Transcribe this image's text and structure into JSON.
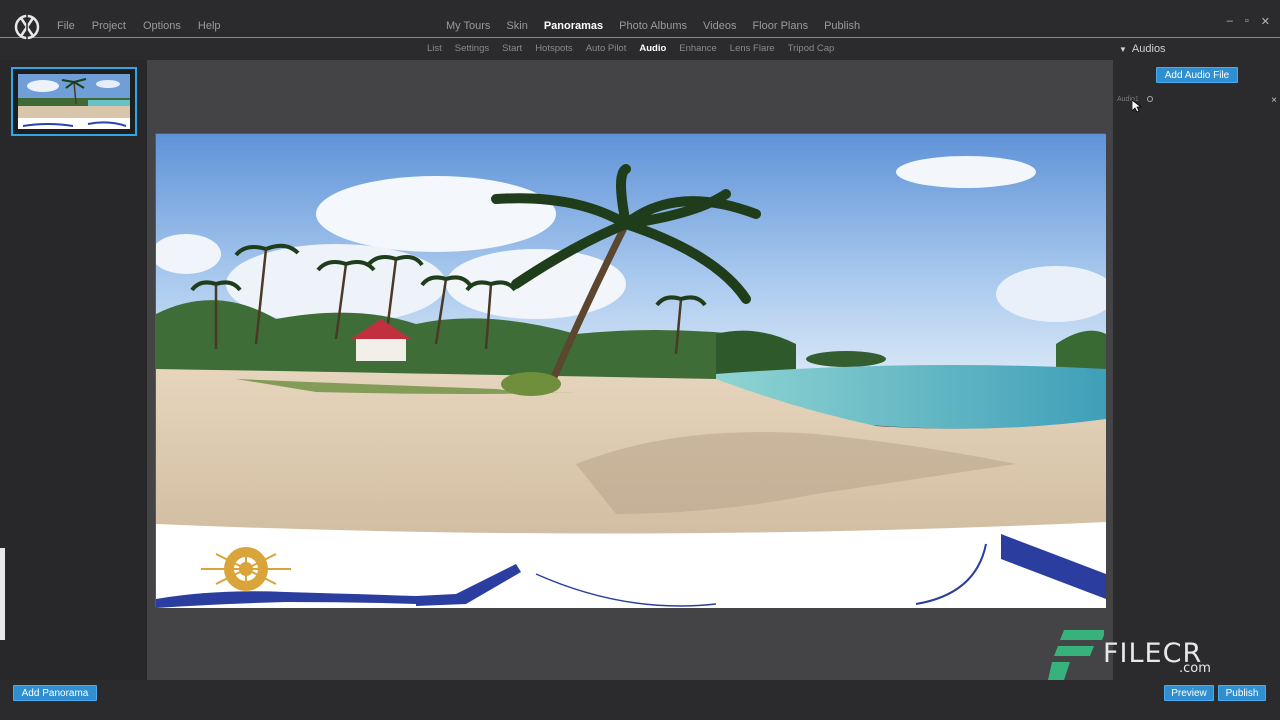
{
  "menu": {
    "file": "File",
    "project": "Project",
    "options": "Options",
    "help": "Help"
  },
  "topnav": {
    "items": [
      "My Tours",
      "Skin",
      "Panoramas",
      "Photo Albums",
      "Videos",
      "Floor Plans",
      "Publish"
    ],
    "active": "Panoramas"
  },
  "subnav": {
    "items": [
      "List",
      "Settings",
      "Start",
      "Hotspots",
      "Auto Pilot",
      "Audio",
      "Enhance",
      "Lens Flare",
      "Tripod Cap"
    ],
    "active": "Audio"
  },
  "window_controls": {
    "minimize": "–",
    "restore": "▫",
    "close": "✕"
  },
  "right_panel": {
    "header": "Audios",
    "add_audio_label": "Add Audio File",
    "audio_item": "Audio1",
    "remove": "×"
  },
  "bottom": {
    "add_panorama": "Add Panorama",
    "preview": "Preview",
    "publish": "Publish"
  },
  "watermark": {
    "text": "FILECR",
    "suffix": ".com"
  },
  "colors": {
    "accent": "#2f8fd0",
    "selection": "#2fa6e6"
  }
}
